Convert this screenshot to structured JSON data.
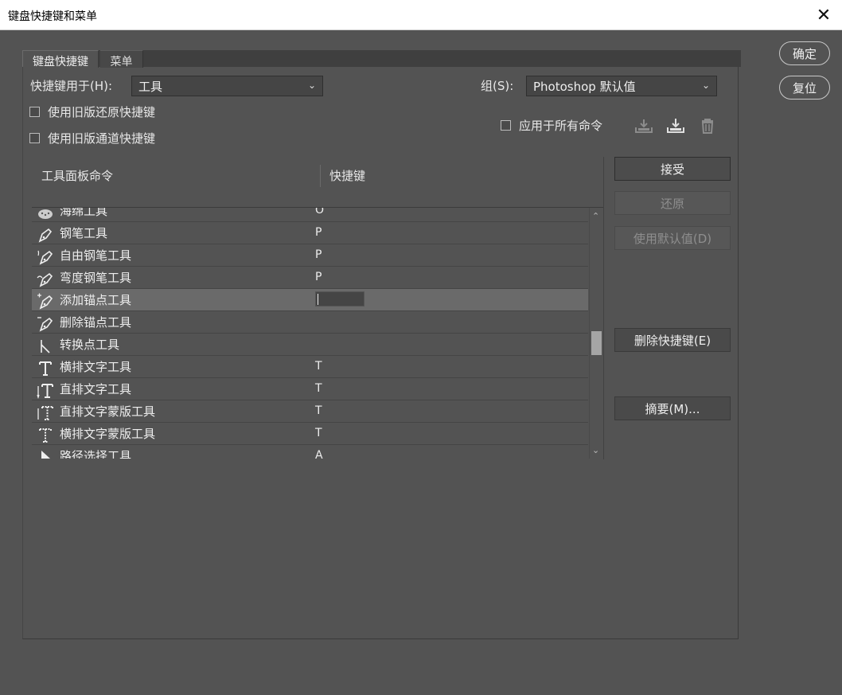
{
  "window": {
    "title": "键盘快捷键和菜单",
    "close_glyph": "✕"
  },
  "dialog_buttons": {
    "ok": "确定",
    "reset": "复位"
  },
  "tabs": [
    {
      "label": "键盘快捷键",
      "active": true
    },
    {
      "label": "菜单",
      "active": false
    }
  ],
  "shortcuts_for": {
    "label": "快捷键用于(H):",
    "value": "工具"
  },
  "group": {
    "label": "组(S):",
    "value": "Photoshop 默认值"
  },
  "checkboxes": {
    "legacy_undo": "使用旧版还原快捷键",
    "legacy_channel": "使用旧版通道快捷键",
    "apply_all": "应用于所有命令"
  },
  "columns": {
    "command": "工具面板命令",
    "shortcut": "快捷键"
  },
  "rows": [
    {
      "name": "海绵工具",
      "key": "O",
      "icon": "sponge-icon"
    },
    {
      "name": "钢笔工具",
      "key": "P",
      "icon": "pen-icon"
    },
    {
      "name": "自由钢笔工具",
      "key": "P",
      "icon": "freeform-pen-icon"
    },
    {
      "name": "弯度钢笔工具",
      "key": "P",
      "icon": "curvature-pen-icon"
    },
    {
      "name": "添加锚点工具",
      "key": "",
      "icon": "add-anchor-icon",
      "selected": true
    },
    {
      "name": "删除锚点工具",
      "key": "",
      "icon": "delete-anchor-icon"
    },
    {
      "name": "转换点工具",
      "key": "",
      "icon": "convert-point-icon"
    },
    {
      "name": "横排文字工具",
      "key": "T",
      "icon": "horizontal-type-icon"
    },
    {
      "name": "直排文字工具",
      "key": "T",
      "icon": "vertical-type-icon"
    },
    {
      "name": "直排文字蒙版工具",
      "key": "T",
      "icon": "vertical-type-mask-icon"
    },
    {
      "name": "横排文字蒙版工具",
      "key": "T",
      "icon": "horizontal-type-mask-icon"
    },
    {
      "name": "路径选择工具",
      "key": "A",
      "icon": "path-selection-icon"
    }
  ],
  "side_buttons": {
    "accept": "接受",
    "undo": "还原",
    "use_default": "使用默认值(D)",
    "delete_shortcut": "删除快捷键(E)",
    "summarize": "摘要(M)..."
  }
}
